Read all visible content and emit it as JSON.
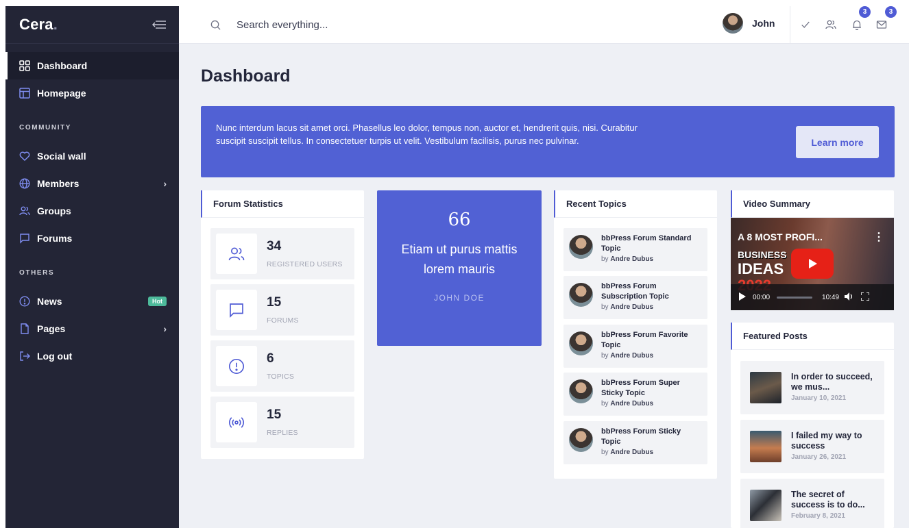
{
  "sidebar": {
    "logo": "Cera",
    "items_main": [
      {
        "label": "Dashboard",
        "icon": "dashboard-grid-icon"
      },
      {
        "label": "Homepage",
        "icon": "layout-icon"
      }
    ],
    "section_community": "COMMUNITY",
    "items_community": [
      {
        "label": "Social wall",
        "icon": "heart-icon"
      },
      {
        "label": "Members",
        "icon": "globe-icon"
      },
      {
        "label": "Groups",
        "icon": "users-icon"
      },
      {
        "label": "Forums",
        "icon": "message-square-icon"
      }
    ],
    "section_others": "OTHERS",
    "items_others": [
      {
        "label": "News",
        "icon": "alert-circle-icon",
        "badge": "Hot"
      },
      {
        "label": "Pages",
        "icon": "file-icon"
      },
      {
        "label": "Log out",
        "icon": "log-out-icon"
      }
    ]
  },
  "topbar": {
    "search_placeholder": "Search everything...",
    "user_name": "John",
    "notifications_count": "3",
    "messages_count": "3"
  },
  "page": {
    "title": "Dashboard"
  },
  "banner": {
    "text": "Nunc interdum lacus sit amet orci. Phasellus leo dolor, tempus non, auctor et, hendrerit quis, nisi. Curabitur suscipit suscipit tellus. In consectetuer turpis ut velit. Vestibulum facilisis, purus nec pulvinar.",
    "button": "Learn more"
  },
  "forum_stats": {
    "title": "Forum Statistics",
    "items": [
      {
        "value": "34",
        "label": "REGISTERED USERS",
        "icon": "users-icon"
      },
      {
        "value": "15",
        "label": "FORUMS",
        "icon": "message-square-icon"
      },
      {
        "value": "6",
        "label": "TOPICS",
        "icon": "alert-circle-icon"
      },
      {
        "value": "15",
        "label": "REPLIES",
        "icon": "broadcast-icon"
      }
    ]
  },
  "quote": {
    "mark": "66",
    "text": "Etiam ut purus mattis lorem mauris",
    "author": "JOHN DOE"
  },
  "recent_topics": {
    "title": "Recent Topics",
    "by_prefix": "by",
    "items": [
      {
        "title": "bbPress Forum Standard Topic",
        "author": "Andre Dubus"
      },
      {
        "title": "bbPress Forum Subscription Topic",
        "author": "Andre Dubus"
      },
      {
        "title": "bbPress Forum Favorite Topic",
        "author": "Andre Dubus"
      },
      {
        "title": "bbPress Forum Super Sticky Topic",
        "author": "Andre Dubus"
      },
      {
        "title": "bbPress Forum Sticky Topic",
        "author": "Andre Dubus"
      }
    ]
  },
  "video": {
    "title": "Video Summary",
    "video_title": "A 8 MOST PROFI...",
    "overlay_line1": "BUSINESS",
    "overlay_line2": "IDEAS",
    "overlay_line3": "2022",
    "time_current": "00:00",
    "time_total": "10:49"
  },
  "featured": {
    "title": "Featured Posts",
    "items": [
      {
        "title": "In order to succeed, we mus...",
        "date": "January 10, 2021"
      },
      {
        "title": "I failed my way to success",
        "date": "January 26, 2021"
      },
      {
        "title": "The secret of success is to do...",
        "date": "February 8, 2021"
      }
    ]
  },
  "colors": {
    "sidebar_bg": "#232536",
    "accent": "#5161d4",
    "page_bg": "#eef0f5",
    "hot_badge": "#4dba9b"
  }
}
